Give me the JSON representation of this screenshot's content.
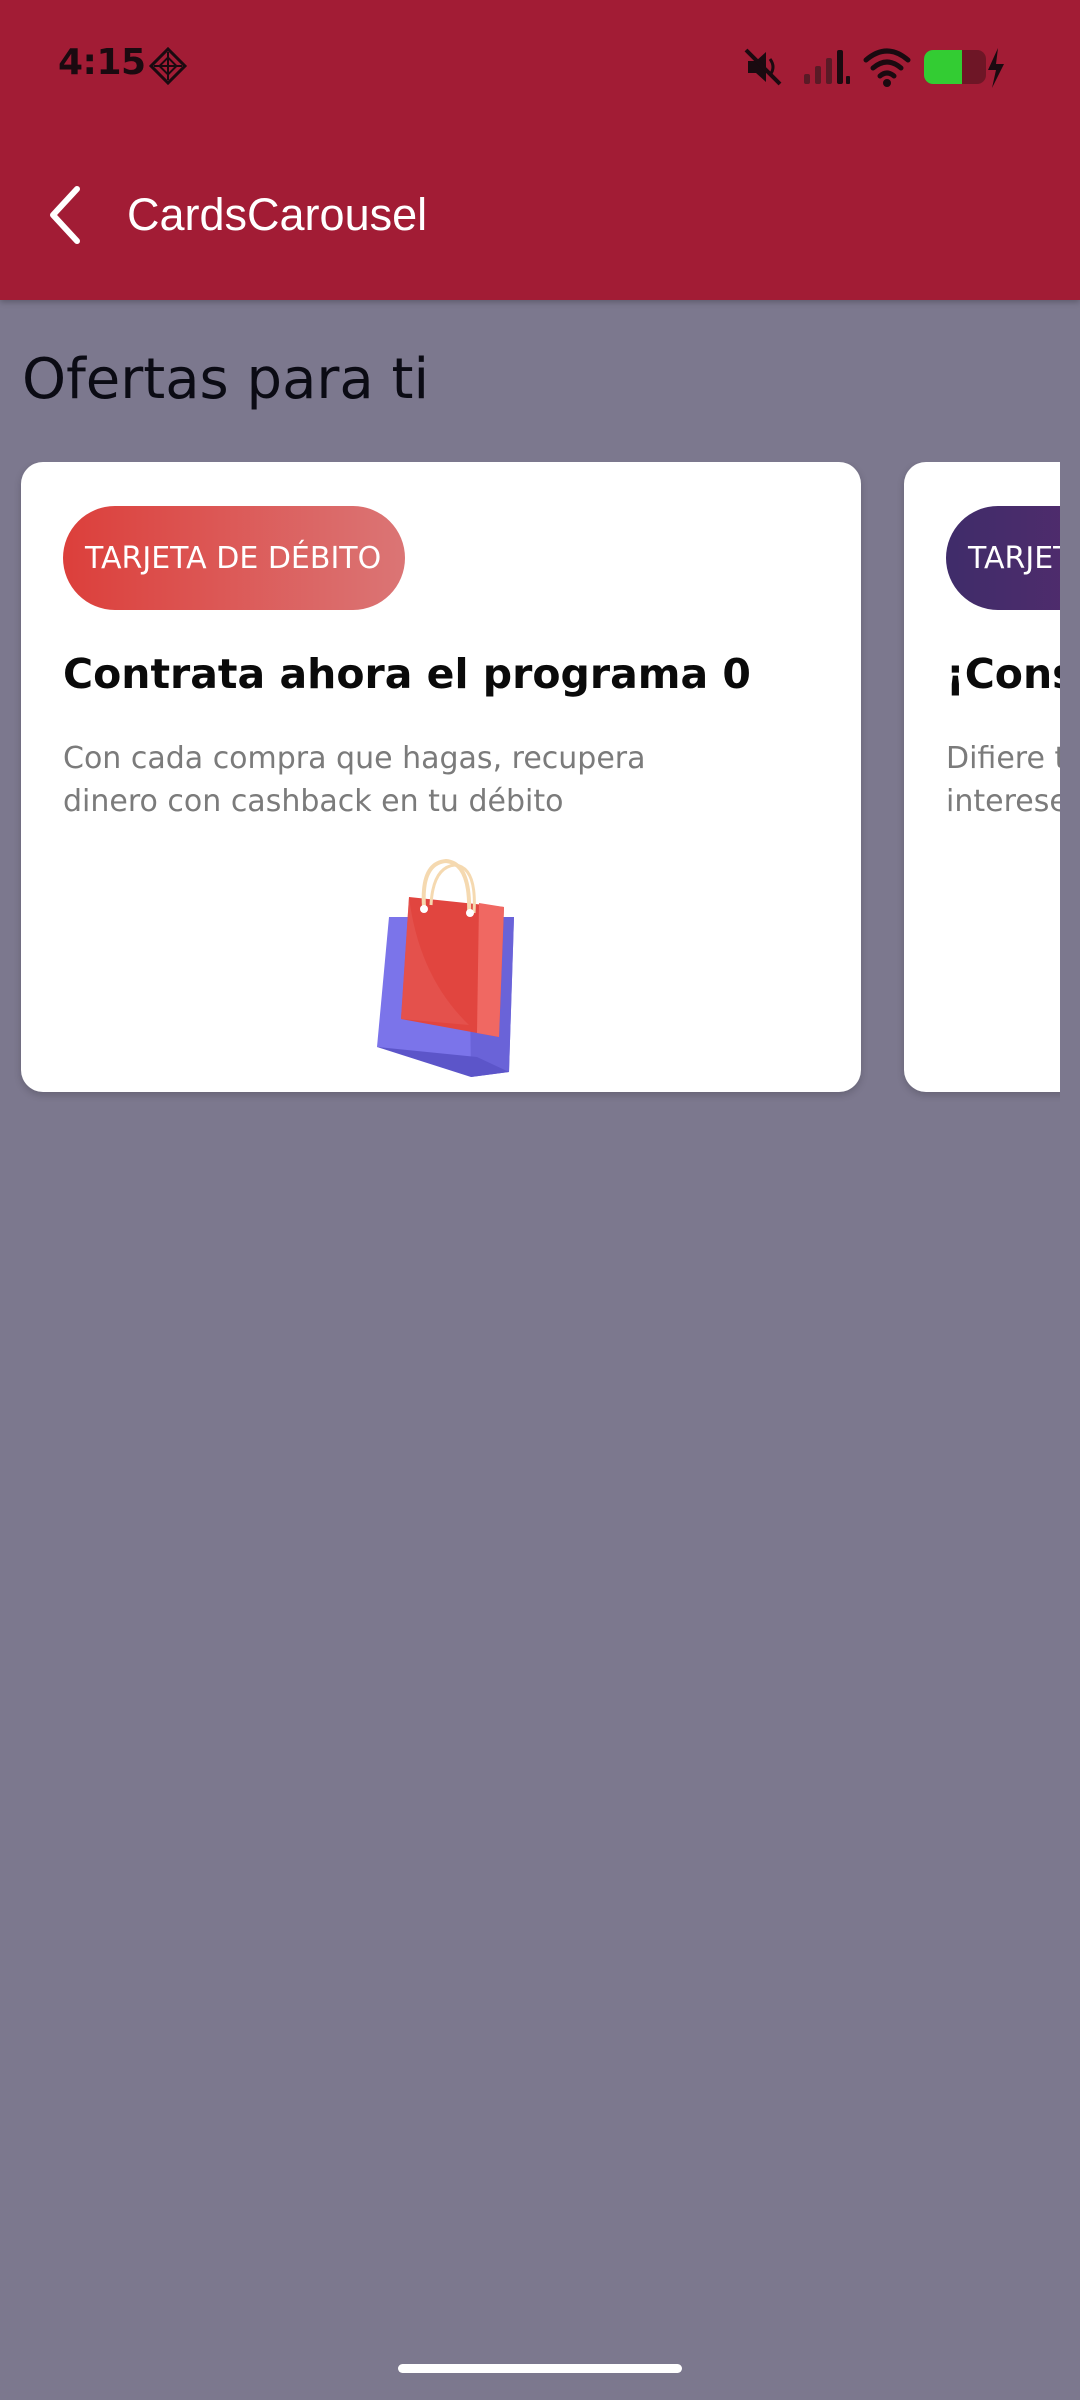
{
  "status_bar": {
    "time": "4:15",
    "icons": [
      "app-diamond-icon",
      "mute-icon",
      "signal-icon",
      "wifi-icon",
      "battery-charging-icon"
    ]
  },
  "app_bar": {
    "title": "CardsCarousel",
    "back_icon": "chevron-left-icon",
    "background_color": "#a21c35"
  },
  "section": {
    "title": "Ofertas para ti"
  },
  "cards": [
    {
      "badge": "TARJETA DE DÉBITO",
      "title": "Contrata ahora el programa 0",
      "description": "Con cada compra que hagas, recupera dinero con cashback en tu débito",
      "illustration": "shopping-bag-icon",
      "badge_colors": [
        "#dc3f3b",
        "#db7575"
      ]
    },
    {
      "badge": "TARJET",
      "title": "¡Cons",
      "description": "Difiere t intereses",
      "badge_colors": [
        "#3f2c6a",
        "#6b2a6f"
      ]
    }
  ],
  "colors": {
    "page_background": "#7c788e",
    "card_background": "#ffffff"
  }
}
